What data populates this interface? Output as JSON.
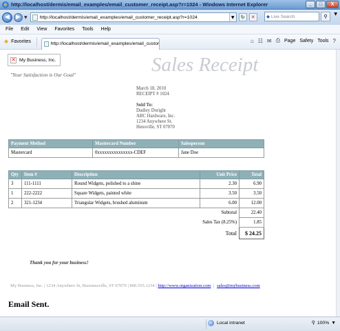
{
  "window": {
    "title": "http://localhost/dermis/email_examples/email_customer_receipt.asp?r=1024 - Windows Internet Explorer",
    "buttons": {
      "minimize": "_",
      "maximize": "□",
      "close": "X"
    }
  },
  "address_bar": {
    "url": "http://localhost/dermis/email_examples/email_customer_receipt.asp?r=1024",
    "search_placeholder": "Live Search"
  },
  "menu": [
    "File",
    "Edit",
    "View",
    "Favorites",
    "Tools",
    "Help"
  ],
  "favorites_bar": {
    "favorites_label": "Favorites",
    "tab_title": "http://localhost/dermis/email_examples/email_custom...",
    "toolbar": {
      "page": "Page",
      "safety": "Safety",
      "tools": "Tools"
    }
  },
  "receipt": {
    "logo_alt": "My Business, Inc.",
    "heading": "Sales Receipt",
    "slogan": "\"Your Satisfaction is Our Goal\"",
    "date": "March 18, 2010",
    "receipt_no": "RECEIPT # 1024",
    "sold_to_label": "Sold To:",
    "sold_to": {
      "name": "Dudley Doright",
      "company": "ABC Hardware, Inc.",
      "street": "1234 Anywhere St.",
      "city": "Hensville, ST 07070"
    },
    "payment": {
      "headers": [
        "Payment Method",
        "Mastercard Number",
        "Salesperson"
      ],
      "row": [
        "Mastercard",
        "0xxxxxxxxxxxxxxx-CDEF",
        "Jane Doe"
      ]
    },
    "items": {
      "headers": [
        "Qty",
        "Item #",
        "Description",
        "Unit Price",
        "Total"
      ],
      "rows": [
        {
          "qty": "3",
          "item": "111-1111",
          "desc": "Round Widgets, polished to a shine",
          "unit": "2.30",
          "total": "6.90"
        },
        {
          "qty": "1",
          "item": "222-2222",
          "desc": "Square Widgets, painted white",
          "unit": "3.50",
          "total": "3.50"
        },
        {
          "qty": "2",
          "item": "321-1234",
          "desc": "Triangular Widgets, brushed aluminum",
          "unit": "6.00",
          "total": "12.00"
        }
      ],
      "subtotal_label": "Subtotal",
      "subtotal": "22.40",
      "tax_label": "Sales Tax (8.25%)",
      "tax": "1.85",
      "total_label": "Total",
      "total": "$ 24.25"
    },
    "thanks": "Thank you for your business!",
    "footer": {
      "text": "My Business, Inc. | 1234 Anywhere St, Businessville, ST 07070 | 800.555.1234 |",
      "website": "http://www.organization.com",
      "email": "sales@mybusiness.com",
      "divider": "|"
    },
    "email_sent": "Email Sent."
  },
  "status_bar": {
    "zone": "Local intranet",
    "zoom": "100%"
  }
}
